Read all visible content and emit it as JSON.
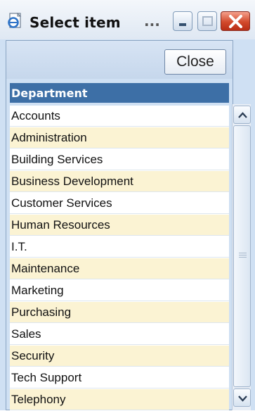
{
  "window": {
    "title": "Select item",
    "title_ellipsis": "...",
    "close_button_label": "Close"
  },
  "list": {
    "header": "Department",
    "items": [
      "Accounts",
      "Administration",
      "Building Services",
      "Business Development",
      "Customer Services",
      "Human Resources",
      "I.T.",
      "Maintenance",
      "Marketing",
      "Purchasing",
      "Sales",
      "Security",
      "Tech Support",
      "Telephony"
    ]
  },
  "icons": {
    "app": "ie-page-icon",
    "minimize": "minimize-icon",
    "maximize": "maximize-icon",
    "close": "close-icon",
    "scroll_up": "chevron-up-icon",
    "scroll_down": "chevron-down-icon"
  },
  "colors": {
    "header_bg": "#3d6fa6",
    "row_alt": "#fbf3d3",
    "title_close": "#d24a2c"
  }
}
